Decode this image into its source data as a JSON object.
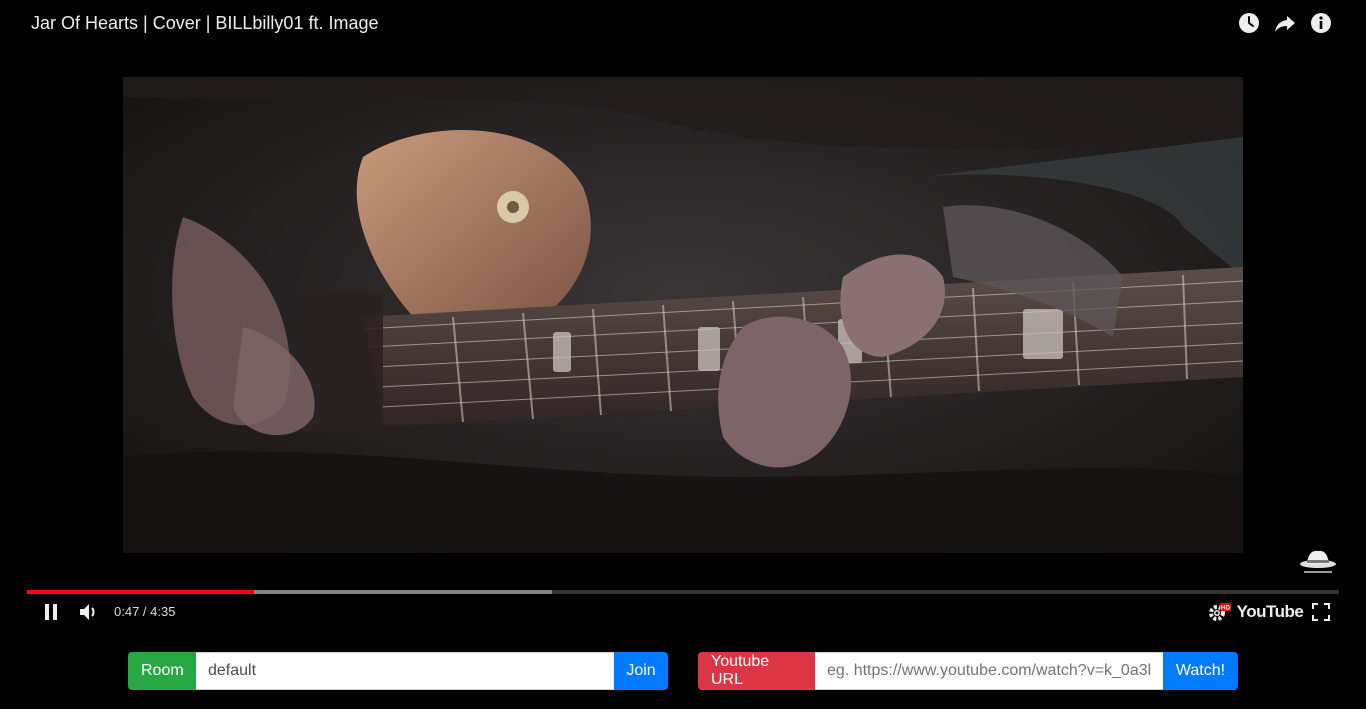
{
  "video": {
    "title": "Jar Of Hearts | Cover | BILLbilly01 ft. Image",
    "time_display": "0:47 / 4:35",
    "played_fraction": 0.173,
    "buffered_fraction": 0.4,
    "youtube_logo_text": "YouTube",
    "hd_badge": "HD",
    "top_icons": [
      "watch-later-icon",
      "share-icon",
      "info-icon"
    ],
    "colors": {
      "progress": "#ff0000"
    }
  },
  "room_bar": {
    "label": "Room",
    "value": "default",
    "button_label": "Join",
    "label_color": "#28a745",
    "button_color": "#007bff"
  },
  "url_bar": {
    "label": "Youtube URL",
    "placeholder": "eg. https://www.youtube.com/watch?v=k_0a3l",
    "button_label": "Watch!",
    "label_color": "#dc3545",
    "button_color": "#007bff"
  }
}
